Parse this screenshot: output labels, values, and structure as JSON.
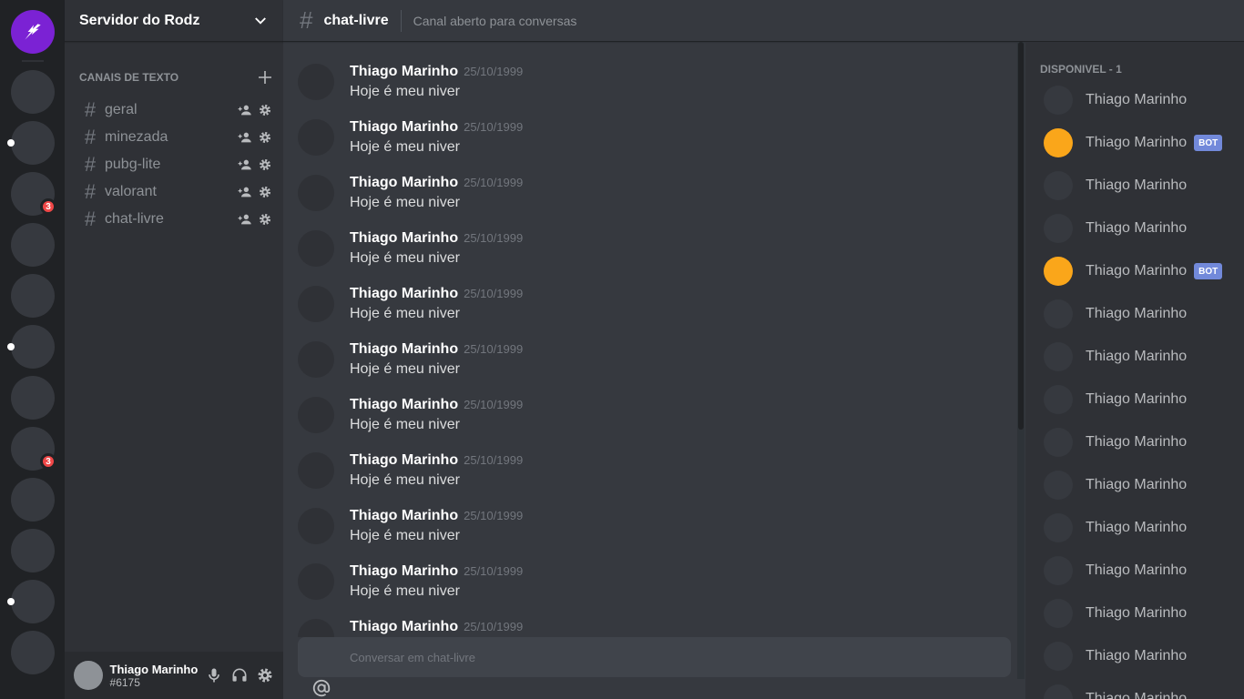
{
  "servers": {
    "home_icon": "falcon-logo-icon",
    "items": [
      {
        "pill": false,
        "badge": ""
      },
      {
        "pill": true,
        "badge": ""
      },
      {
        "pill": false,
        "badge": "3"
      },
      {
        "pill": false,
        "badge": ""
      },
      {
        "pill": false,
        "badge": ""
      },
      {
        "pill": true,
        "badge": ""
      },
      {
        "pill": false,
        "badge": ""
      },
      {
        "pill": false,
        "badge": "3"
      },
      {
        "pill": false,
        "badge": ""
      },
      {
        "pill": false,
        "badge": ""
      },
      {
        "pill": true,
        "badge": ""
      },
      {
        "pill": false,
        "badge": ""
      }
    ]
  },
  "guild": {
    "name": "Servidor do Rodz",
    "category": "CANAIS DE TEXTO",
    "add_icon": "plus-icon",
    "channels": [
      {
        "name": "geral"
      },
      {
        "name": "minezada"
      },
      {
        "name": "pubg-lite"
      },
      {
        "name": "valorant"
      },
      {
        "name": "chat-livre"
      }
    ]
  },
  "user": {
    "name": "Thiago Marinho",
    "tag": "#6175"
  },
  "chat": {
    "channel": "chat-livre",
    "topic": "Canal aberto para conversas",
    "input_placeholder": "Conversar em chat-livre",
    "messages": [
      {
        "author": "Thiago Marinho",
        "date": "25/10/1999",
        "text": "Hoje é meu niver"
      },
      {
        "author": "Thiago Marinho",
        "date": "25/10/1999",
        "text": "Hoje é meu niver"
      },
      {
        "author": "Thiago Marinho",
        "date": "25/10/1999",
        "text": "Hoje é meu niver"
      },
      {
        "author": "Thiago Marinho",
        "date": "25/10/1999",
        "text": "Hoje é meu niver"
      },
      {
        "author": "Thiago Marinho",
        "date": "25/10/1999",
        "text": "Hoje é meu niver"
      },
      {
        "author": "Thiago Marinho",
        "date": "25/10/1999",
        "text": "Hoje é meu niver"
      },
      {
        "author": "Thiago Marinho",
        "date": "25/10/1999",
        "text": "Hoje é meu niver"
      },
      {
        "author": "Thiago Marinho",
        "date": "25/10/1999",
        "text": "Hoje é meu niver"
      },
      {
        "author": "Thiago Marinho",
        "date": "25/10/1999",
        "text": "Hoje é meu niver"
      },
      {
        "author": "Thiago Marinho",
        "date": "25/10/1999",
        "text": "Hoje é meu niver"
      },
      {
        "author": "Thiago Marinho",
        "date": "25/10/1999",
        "text": ""
      }
    ]
  },
  "members": {
    "category": "DISPONIVEL - 1",
    "bot_label": "BOT",
    "list": [
      {
        "name": "Thiago Marinho",
        "bot": false
      },
      {
        "name": "Thiago Marinho",
        "bot": true
      },
      {
        "name": "Thiago Marinho",
        "bot": false
      },
      {
        "name": "Thiago Marinho",
        "bot": false
      },
      {
        "name": "Thiago Marinho",
        "bot": true
      },
      {
        "name": "Thiago Marinho",
        "bot": false
      },
      {
        "name": "Thiago Marinho",
        "bot": false
      },
      {
        "name": "Thiago Marinho",
        "bot": false
      },
      {
        "name": "Thiago Marinho",
        "bot": false
      },
      {
        "name": "Thiago Marinho",
        "bot": false
      },
      {
        "name": "Thiago Marinho",
        "bot": false
      },
      {
        "name": "Thiago Marinho",
        "bot": false
      },
      {
        "name": "Thiago Marinho",
        "bot": false
      },
      {
        "name": "Thiago Marinho",
        "bot": false
      },
      {
        "name": "Thiago Marinho",
        "bot": false
      }
    ]
  },
  "colors": {
    "brand": "#7b22d4",
    "bot_badge": "#7289da",
    "bot_avatar": "#faa61a",
    "mention_badge": "#f04747"
  }
}
